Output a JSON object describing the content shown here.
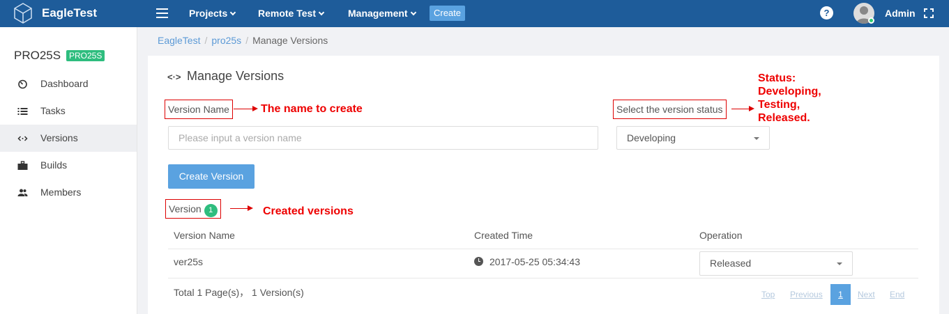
{
  "topbar": {
    "brand": "EagleTest",
    "menus": [
      "Projects",
      "Remote Test",
      "Management"
    ],
    "create_label": "Create",
    "help_label": "?",
    "user_name": "Admin"
  },
  "sidebar": {
    "project_name": "PRO25S",
    "project_badge": "PRO25S",
    "items": [
      {
        "label": "Dashboard",
        "icon": "dashboard-icon"
      },
      {
        "label": "Tasks",
        "icon": "list-icon"
      },
      {
        "label": "Versions",
        "icon": "code-arrows-icon"
      },
      {
        "label": "Builds",
        "icon": "briefcase-icon"
      },
      {
        "label": "Members",
        "icon": "users-icon"
      }
    ]
  },
  "breadcrumb": {
    "root": "EagleTest",
    "project": "pro25s",
    "current": "Manage Versions",
    "separator": "/"
  },
  "main": {
    "title_icon": "<·>",
    "title": "Manage Versions",
    "version_name_label": "Version Name",
    "version_name_placeholder": "Please input a version name",
    "status_label": "Select the version status",
    "status_value": "Developing",
    "create_button": "Create Version",
    "version_section_label": "Version",
    "version_count": "1",
    "table": {
      "headers": [
        "Version Name",
        "Created Time",
        "Operation"
      ],
      "rows": [
        {
          "name": "ver25s",
          "created": "2017-05-25 05:34:43",
          "operation": "Released"
        }
      ]
    },
    "total_text": "Total 1 Page(s)，  1  Version(s)",
    "pagination": {
      "top": "Top",
      "previous": "Previous",
      "page": "1",
      "next": "Next",
      "end": "End"
    }
  },
  "annotations": {
    "name_note": "The name to create",
    "status_note": [
      "Status:",
      "Developing,",
      "Testing,",
      "Released."
    ],
    "versions_note": "Created versions"
  },
  "colors": {
    "topbar": "#1e5c9a",
    "accent": "#5aa2e0",
    "badge": "#2ebd7e",
    "annotation": "#dd0000"
  }
}
